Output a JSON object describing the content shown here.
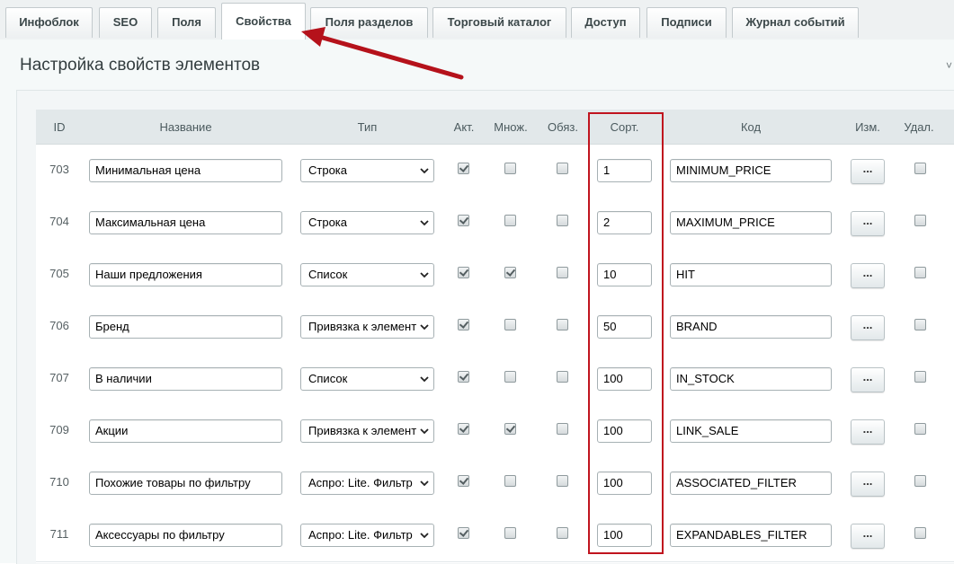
{
  "tabs": [
    {
      "label": "Инфоблок"
    },
    {
      "label": "SEO"
    },
    {
      "label": "Поля"
    },
    {
      "label": "Свойства",
      "active": true
    },
    {
      "label": "Поля разделов"
    },
    {
      "label": "Торговый каталог"
    },
    {
      "label": "Доступ"
    },
    {
      "label": "Подписи"
    },
    {
      "label": "Журнал событий"
    }
  ],
  "section": {
    "title": "Настройка свойств элементов"
  },
  "table": {
    "headers": {
      "id": "ID",
      "name": "Название",
      "type": "Тип",
      "active": "Акт.",
      "multiple": "Множ.",
      "required": "Обяз.",
      "sort": "Сорт.",
      "code": "Код",
      "edit": "Изм.",
      "delete": "Удал."
    },
    "rows": [
      {
        "id": "703",
        "name": "Минимальная цена",
        "type": "Строка",
        "active": true,
        "multiple": false,
        "required": false,
        "sort": "1",
        "code": "MINIMUM_PRICE",
        "edit": "...",
        "delete": false
      },
      {
        "id": "704",
        "name": "Максимальная цена",
        "type": "Строка",
        "active": true,
        "multiple": false,
        "required": false,
        "sort": "2",
        "code": "MAXIMUM_PRICE",
        "edit": "...",
        "delete": false
      },
      {
        "id": "705",
        "name": "Наши предложения",
        "type": "Список",
        "active": true,
        "multiple": true,
        "required": false,
        "sort": "10",
        "code": "HIT",
        "edit": "...",
        "delete": false
      },
      {
        "id": "706",
        "name": "Бренд",
        "type": "Привязка к элемент",
        "active": true,
        "multiple": false,
        "required": false,
        "sort": "50",
        "code": "BRAND",
        "edit": "...",
        "delete": false
      },
      {
        "id": "707",
        "name": "В наличии",
        "type": "Список",
        "active": true,
        "multiple": false,
        "required": false,
        "sort": "100",
        "code": "IN_STOCK",
        "edit": "...",
        "delete": false
      },
      {
        "id": "709",
        "name": "Акции",
        "type": "Привязка к элемент",
        "active": true,
        "multiple": true,
        "required": false,
        "sort": "100",
        "code": "LINK_SALE",
        "edit": "...",
        "delete": false
      },
      {
        "id": "710",
        "name": "Похожие товары по фильтру",
        "type": "Аспро: Lite. Фильтр",
        "active": true,
        "multiple": false,
        "required": false,
        "sort": "100",
        "code": "ASSOCIATED_FILTER",
        "edit": "...",
        "delete": false
      },
      {
        "id": "711",
        "name": "Аксессуары по фильтру",
        "type": "Аспро: Lite. Фильтр",
        "active": true,
        "multiple": false,
        "required": false,
        "sort": "100",
        "code": "EXPANDABLES_FILTER",
        "edit": "...",
        "delete": false
      }
    ]
  },
  "colors": {
    "highlight": "#c0141e",
    "arrow": "#b5121b"
  }
}
